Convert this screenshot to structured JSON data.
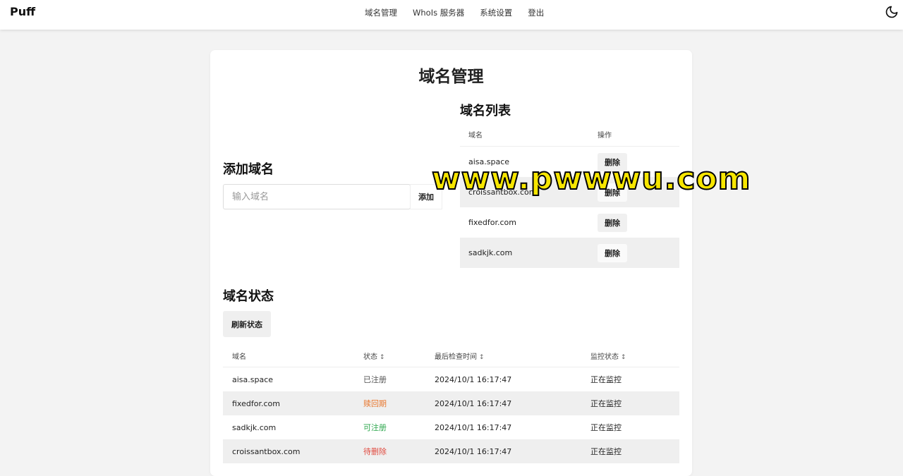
{
  "header": {
    "brand": "Puff",
    "nav": [
      "域名管理",
      "WhoIs 服务器",
      "系统设置",
      "登出"
    ],
    "theme_icon": "moon-icon"
  },
  "page": {
    "title": "域名管理"
  },
  "add_domain": {
    "heading": "添加域名",
    "placeholder": "输入域名",
    "button": "添加"
  },
  "domain_list": {
    "heading": "域名列表",
    "col_name": "域名",
    "col_action": "操作",
    "rows": [
      {
        "name": "aisa.space",
        "action": "删除"
      },
      {
        "name": "croissantbox.com",
        "action": "删除"
      },
      {
        "name": "fixedfor.com",
        "action": "删除"
      },
      {
        "name": "sadkjk.com",
        "action": "删除"
      }
    ]
  },
  "domain_status": {
    "heading": "域名状态",
    "refresh_button": "刷新状态",
    "columns": [
      "域名",
      "状态",
      "最后检查时间",
      "监控状态"
    ],
    "rows": [
      {
        "name": "aisa.space",
        "status": "已注册",
        "status_color": "#555555",
        "checked": "2024/10/1 16:17:47",
        "monitor": "正在监控"
      },
      {
        "name": "fixedfor.com",
        "status": "赎回期",
        "status_color": "#e8772e",
        "checked": "2024/10/1 16:17:47",
        "monitor": "正在监控"
      },
      {
        "name": "sadkjk.com",
        "status": "可注册",
        "status_color": "#2fa84f",
        "checked": "2024/10/1 16:17:47",
        "monitor": "正在监控"
      },
      {
        "name": "croissantbox.com",
        "status": "待删除",
        "status_color": "#e04a3f",
        "checked": "2024/10/1 16:17:47",
        "monitor": "正在监控"
      }
    ]
  },
  "watermark": "www.pwwwu.com"
}
